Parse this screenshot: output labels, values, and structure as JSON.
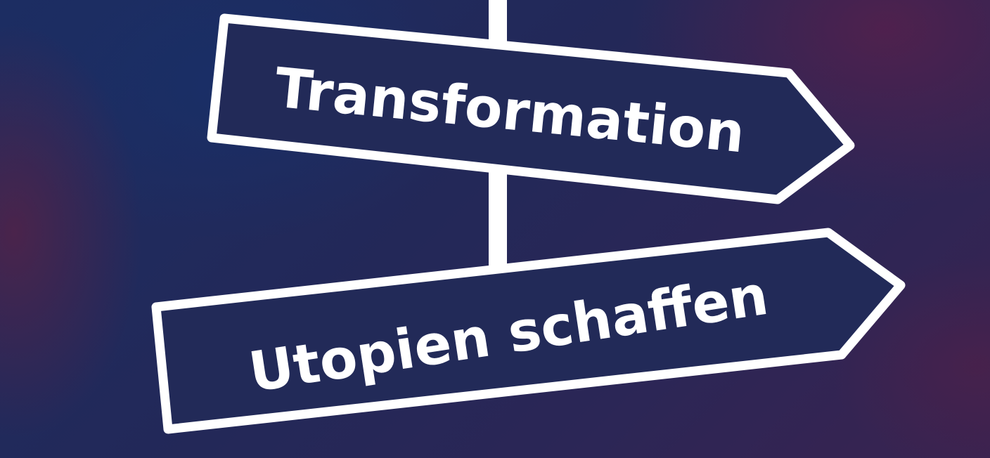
{
  "signs": {
    "upper": {
      "label": "Transformation"
    },
    "lower": {
      "label": "Utopien schaffen"
    }
  },
  "colors": {
    "sign_stroke": "#ffffff",
    "text": "#ffffff",
    "background_blue": "#1f2a57",
    "background_magenta": "#6e1c46"
  }
}
